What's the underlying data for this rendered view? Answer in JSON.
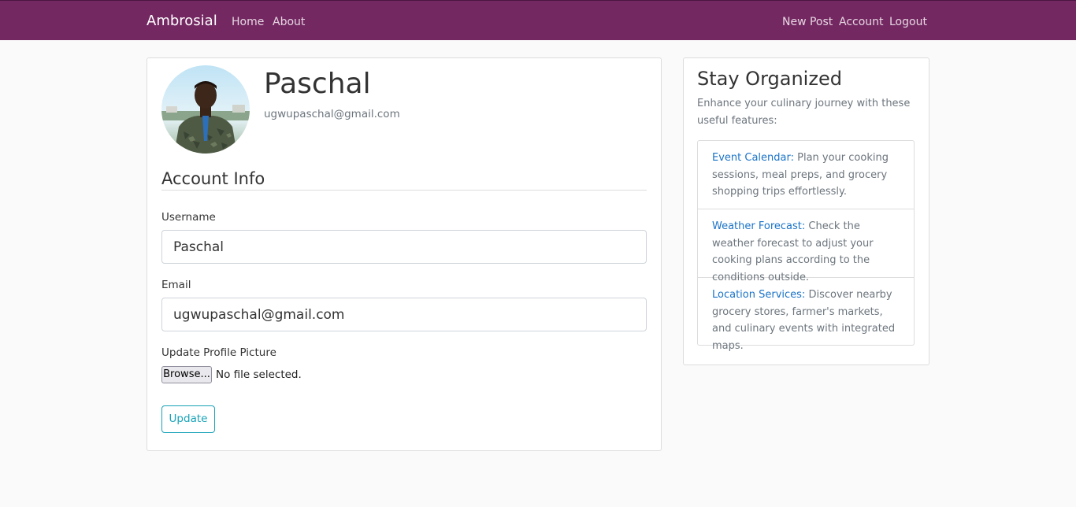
{
  "navbar": {
    "brand": "Ambrosial",
    "left_links": [
      "Home",
      "About"
    ],
    "right_links": [
      "New Post",
      "Account",
      "Logout"
    ],
    "background": "#742862"
  },
  "profile": {
    "name": "Paschal",
    "email": "ugwupaschal@gmail.com",
    "avatar_icon": "profile-photo"
  },
  "account_form": {
    "section_title": "Account Info",
    "username_label": "Username",
    "username_value": "Paschal",
    "email_label": "Email",
    "email_value": "ugwupaschal@gmail.com",
    "picture_label": "Update Profile Picture",
    "browse_label": "Browse...",
    "file_status": "No file selected.",
    "submit_label": "Update",
    "accent_color": "#17a2b8"
  },
  "sidebar": {
    "title": "Stay Organized",
    "description": "Enhance your culinary journey with these useful features:",
    "features": [
      {
        "link": "Event Calendar:",
        "text": "Plan your cooking sessions, meal preps, and grocery shopping trips effortlessly."
      },
      {
        "link": "Weather Forecast:",
        "text": "Check the weather forecast to adjust your cooking plans according to the conditions outside."
      },
      {
        "link": "Location Services:",
        "text": "Discover nearby grocery stores, farmer's markets, and culinary events with integrated maps."
      }
    ],
    "link_color": "#1a73c8"
  }
}
